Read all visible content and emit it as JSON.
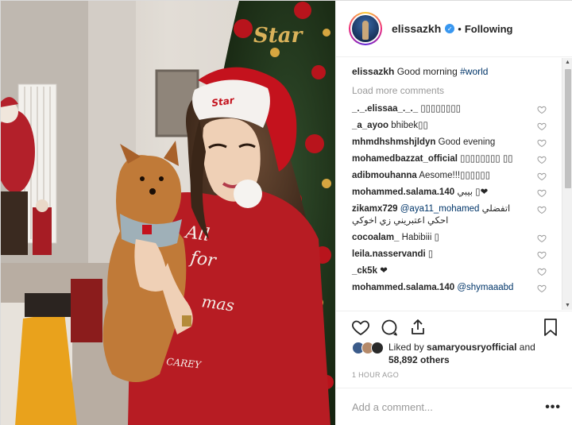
{
  "colors": {
    "accent_link": "#003569",
    "verified": "#3897f0",
    "muted": "#999999",
    "text": "#262626"
  },
  "photo": {
    "hat_text": "Star",
    "tree_text": "Star",
    "sweater_text": "All I want for Christmas",
    "sweater_signature": "Mariah Carey"
  },
  "header": {
    "username": "elissazkh",
    "separator": "•",
    "follow_label": "Following",
    "verified_icon": "verified-badge-icon"
  },
  "caption": {
    "username": "elissazkh",
    "text": "Good morning",
    "hashtag": "#world"
  },
  "load_more_label": "Load more comments",
  "comments": [
    {
      "username": "_._.elissaa_._._",
      "text": "▯▯▯▯▯▯▯▯"
    },
    {
      "username": "_a_ayoo",
      "text": "bhibek▯▯"
    },
    {
      "username": "mhmdhshmshjldyn",
      "text": "Good evening"
    },
    {
      "username": "mohamedbazzat_official",
      "text": "▯▯▯▯▯▯▯▯ ▯▯"
    },
    {
      "username": "adibmouhanna",
      "text": "Aesome!!!▯▯▯▯▯▯"
    },
    {
      "username": "mohammed.salama.140",
      "text": "بيبي ▯❤"
    },
    {
      "username": "zikamx729",
      "mention": "@aya11_mohamed",
      "text": "اتفضلي",
      "text2": "احكي اعتبريني زي اخوكي"
    },
    {
      "username": "cocoalam_",
      "text": "Habibiii ▯"
    },
    {
      "username": "leila.nasservandi",
      "text": "▯"
    },
    {
      "username": "_ck5k",
      "text": "❤"
    },
    {
      "username": "mohammed.salama.140",
      "mention": "@shymaaabd",
      "text": ""
    }
  ],
  "actions": {
    "like_icon": "heart-icon",
    "comment_icon": "comment-icon",
    "share_icon": "share-icon",
    "save_icon": "bookmark-icon"
  },
  "likes": {
    "prefix": "Liked by",
    "user": "samaryousryofficial",
    "joiner": "and",
    "count": "58,892 others"
  },
  "timestamp": "1 HOUR AGO",
  "add_comment": {
    "placeholder": "Add a comment...",
    "more_label": "•••"
  }
}
